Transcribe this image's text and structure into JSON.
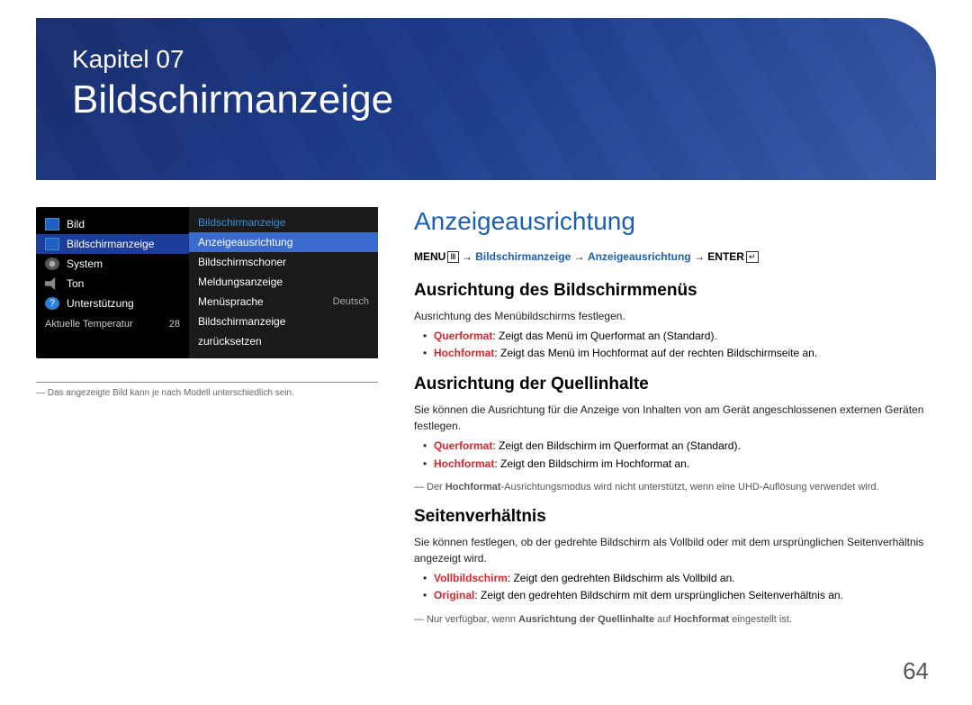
{
  "banner": {
    "chapter": "Kapitel 07",
    "title": "Bildschirmanzeige"
  },
  "menu": {
    "left": {
      "items": [
        {
          "label": "Bild",
          "icon": "box"
        },
        {
          "label": "Bildschirmanzeige",
          "icon": "box",
          "selected": true
        },
        {
          "label": "System",
          "icon": "gear"
        },
        {
          "label": "Ton",
          "icon": "speaker"
        },
        {
          "label": "Unterstützung",
          "icon": "help"
        }
      ],
      "temp_label": "Aktuelle Temperatur",
      "temp_value": "28"
    },
    "right": {
      "header": "Bildschirmanzeige",
      "items": [
        {
          "label": "Anzeigeausrichtung",
          "selected": true
        },
        {
          "label": "Bildschirmschoner"
        },
        {
          "label": "Meldungsanzeige"
        },
        {
          "label": "Menüsprache",
          "value": "Deutsch"
        },
        {
          "label": "Bildschirmanzeige"
        },
        {
          "label": "zurücksetzen"
        }
      ]
    }
  },
  "caption": "Das angezeigte Bild kann je nach Modell unterschiedlich sein.",
  "main": {
    "heading": "Anzeigeausrichtung",
    "path": {
      "menu": "MENU",
      "seg1": "Bildschirmanzeige",
      "seg2": "Anzeigeausrichtung",
      "enter": "ENTER"
    },
    "s1": {
      "h": "Ausrichtung des Bildschirmmenüs",
      "intro": "Ausrichtung des Menübildschirms festlegen.",
      "b1": {
        "term": "Querformat",
        "rest": ": Zeigt das Menü im Querformat an (Standard)."
      },
      "b2": {
        "term": "Hochformat",
        "rest": ": Zeigt das Menü im Hochformat auf der rechten Bildschirmseite an."
      }
    },
    "s2": {
      "h": "Ausrichtung der Quellinhalte",
      "intro": "Sie können die Ausrichtung für die Anzeige von Inhalten von am Gerät angeschlossenen externen Geräten festlegen.",
      "b1": {
        "term": "Querformat",
        "rest": ": Zeigt den Bildschirm im Querformat an (Standard)."
      },
      "b2": {
        "term": "Hochformat",
        "rest": ": Zeigt den Bildschirm im Hochformat an."
      },
      "note_pre": "Der ",
      "note_bold": "Hochformat",
      "note_post": "-Ausrichtungsmodus wird nicht unterstützt, wenn eine UHD-Auflösung verwendet wird."
    },
    "s3": {
      "h": "Seitenverhältnis",
      "intro": "Sie können festlegen, ob der gedrehte Bildschirm als Vollbild oder mit dem ursprünglichen Seitenverhältnis angezeigt wird.",
      "b1": {
        "term": "Vollbildschirm",
        "rest": ": Zeigt den gedrehten Bildschirm als Vollbild an."
      },
      "b2": {
        "term": "Original",
        "rest": ": Zeigt den gedrehten Bildschirm mit dem ursprünglichen Seitenverhältnis an."
      },
      "note_pre": "Nur verfügbar, wenn ",
      "note_b1": "Ausrichtung der Quellinhalte",
      "note_mid": " auf ",
      "note_b2": "Hochformat",
      "note_post": " eingestellt ist."
    }
  },
  "pagenum": "64"
}
